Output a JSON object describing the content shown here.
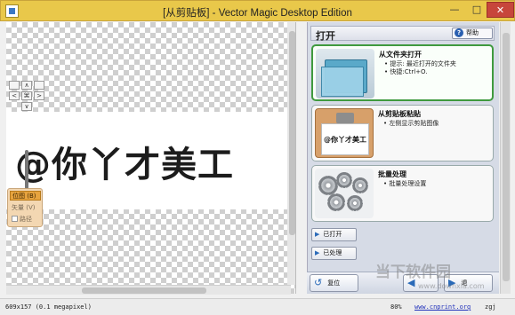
{
  "window": {
    "title": "[从剪贴板] - Vector Magic Desktop Edition",
    "minimize_glyph": "—",
    "maximize_glyph": "□",
    "close_glyph": "✕"
  },
  "canvas": {
    "art_text": "@你丫才美工",
    "nav": {
      "up": "∧",
      "left": "<",
      "center": "⌘",
      "right": ">",
      "down": "∨"
    },
    "modes": [
      {
        "label": "位图 (B)",
        "active": true
      },
      {
        "label": "矢量 (V)",
        "active": false
      },
      {
        "label": "路径",
        "active": false,
        "checkbox": true
      }
    ]
  },
  "panel": {
    "title": "打开",
    "help_label": "帮助",
    "cards": [
      {
        "title": "从文件夹打开",
        "lines": [
          "• 提示: 最近打开的文件夹",
          "• 快捷:Ctrl+O."
        ],
        "icon": "folder-icon"
      },
      {
        "title": "从剪贴板粘贴",
        "lines": [
          "• 左侧显示剪贴图像"
        ],
        "icon": "clipboard-icon",
        "thumb_text": "@你丫才美工"
      },
      {
        "title": "批量处理",
        "lines": [
          "• 批量处理设置"
        ],
        "icon": "gears-icon"
      }
    ],
    "opened_label": "已打开",
    "processed_label": "已处理",
    "back_label": "复位",
    "next_label": "退"
  },
  "status": {
    "dimensions": "609x157 (0.1 megapixel)",
    "zoom": "80%",
    "link": "www.cnprint.org",
    "version": "zgj"
  },
  "watermark": {
    "text": "当下软件园",
    "url": "www.downxia.com"
  }
}
